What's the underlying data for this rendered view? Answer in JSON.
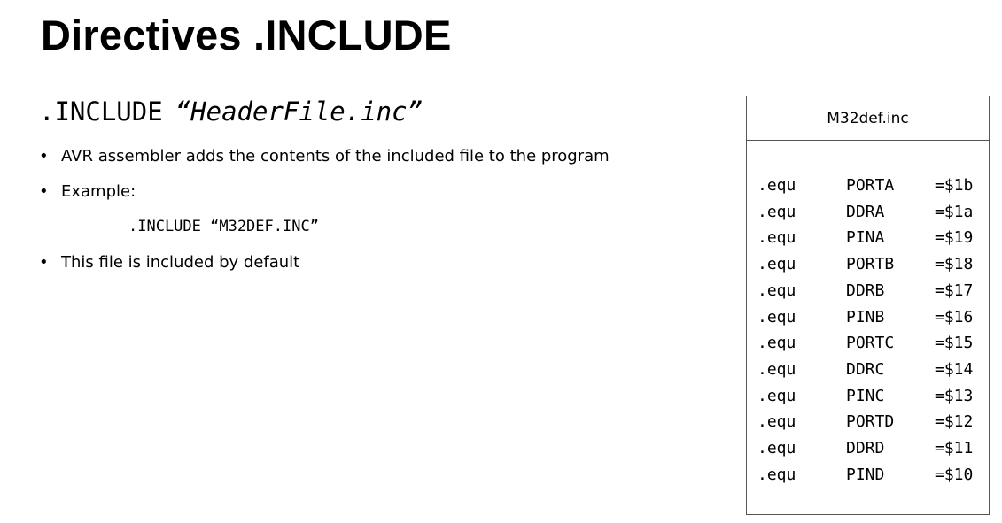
{
  "slide": {
    "title": "Directives .INCLUDE",
    "directive": {
      "keyword": ".INCLUDE",
      "filename": "“HeaderFile.inc”"
    },
    "bullets": {
      "item1": "AVR assembler adds the contents of the included file to the program",
      "item2": "Example:",
      "example_code": ".INCLUDE “M32DEF.INC”",
      "item3": "This file is included by default"
    }
  },
  "file_box": {
    "title": "M32def.inc",
    "rows": [
      {
        "directive": ".equ",
        "name": "PORTA",
        "value": "=$1b"
      },
      {
        "directive": ".equ",
        "name": "DDRA",
        "value": "=$1a"
      },
      {
        "directive": ".equ",
        "name": "PINA",
        "value": "=$19"
      },
      {
        "directive": ".equ",
        "name": "PORTB",
        "value": "=$18"
      },
      {
        "directive": ".equ",
        "name": "DDRB",
        "value": "=$17"
      },
      {
        "directive": ".equ",
        "name": "PINB",
        "value": "=$16"
      },
      {
        "directive": ".equ",
        "name": "PORTC",
        "value": "=$15"
      },
      {
        "directive": ".equ",
        "name": "DDRC",
        "value": "=$14"
      },
      {
        "directive": ".equ",
        "name": "PINC",
        "value": "=$13"
      },
      {
        "directive": ".equ",
        "name": "PORTD",
        "value": "=$12"
      },
      {
        "directive": ".equ",
        "name": "DDRD",
        "value": "=$11"
      },
      {
        "directive": ".equ",
        "name": "PIND",
        "value": "=$10"
      }
    ]
  }
}
